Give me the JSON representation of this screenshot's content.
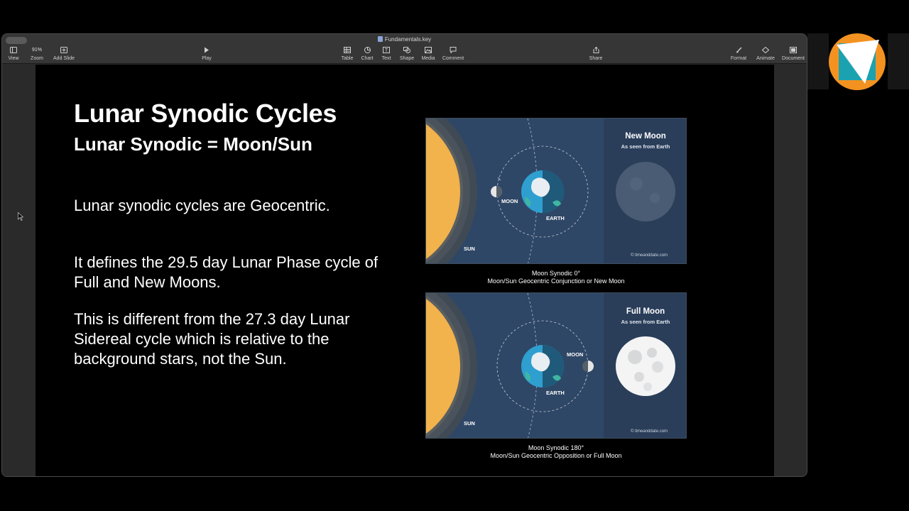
{
  "window": {
    "title": "Fundamentals.key"
  },
  "toolbar": {
    "view_label": "View",
    "zoom_value": "91%",
    "zoom_label": "Zoom",
    "add_slide_label": "Add Slide",
    "play_label": "Play",
    "table_label": "Table",
    "chart_label": "Chart",
    "text_label": "Text",
    "shape_label": "Shape",
    "media_label": "Media",
    "comment_label": "Comment",
    "share_label": "Share",
    "format_label": "Format",
    "animate_label": "Animate",
    "document_label": "Document"
  },
  "slide": {
    "title": "Lunar Synodic Cycles",
    "subtitle": "Lunar Synodic = Moon/Sun",
    "paragraphs": [
      "Lunar synodic cycles are Geocentric.",
      "It defines the 29.5 day Lunar Phase cycle of Full and New Moons.",
      "This is different from the 27.3 day Lunar Sidereal cycle which is relative to the background stars, not the Sun."
    ],
    "diagram_top": {
      "phase_title": "New Moon",
      "phase_subtitle": "As seen from Earth",
      "moon_label": "MOON",
      "earth_label": "EARTH",
      "sun_label": "SUN",
      "credit": "© timeanddate.com",
      "caption_line1": "Moon Synodic 0°",
      "caption_line2": "Moon/Sun Geocentric Conjunction or New Moon"
    },
    "diagram_bottom": {
      "phase_title": "Full Moon",
      "phase_subtitle": "As seen from Earth",
      "moon_label": "MOON",
      "earth_label": "EARTH",
      "sun_label": "SUN",
      "credit": "© timeanddate.com",
      "caption_line1": "Moon Synodic 180°",
      "caption_line2": "Moon/Sun Geocentric Opposition or Full Moon"
    }
  },
  "colors": {
    "sun": "#f2b24c",
    "space": "#2f4766",
    "panel": "#2a3e5a",
    "ocean": "#2f9fd0",
    "land": "#3fb6a0",
    "logo_orange": "#f39221",
    "logo_teal": "#1aa2b0"
  }
}
